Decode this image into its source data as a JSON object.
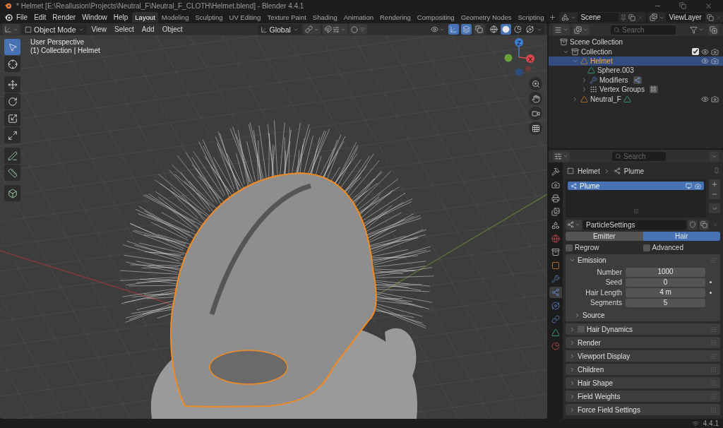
{
  "title_bar": {
    "title": "* Helmet [E:\\Reallusion\\Projects\\Neutral_F\\Neutral_F_CLOTH\\Helmet.blend] - Blender 4.4.1"
  },
  "menus": [
    "File",
    "Edit",
    "Render",
    "Window",
    "Help"
  ],
  "workspaces": [
    {
      "label": "Layout",
      "selected": true
    },
    {
      "label": "Modeling",
      "selected": false
    },
    {
      "label": "Sculpting",
      "selected": false
    },
    {
      "label": "UV Editing",
      "selected": false
    },
    {
      "label": "Texture Paint",
      "selected": false
    },
    {
      "label": "Shading",
      "selected": false
    },
    {
      "label": "Animation",
      "selected": false
    },
    {
      "label": "Rendering",
      "selected": false
    },
    {
      "label": "Compositing",
      "selected": false
    },
    {
      "label": "Geometry Nodes",
      "selected": false
    },
    {
      "label": "Scripting",
      "selected": false
    }
  ],
  "scene": {
    "scene": "Scene",
    "view_layer": "ViewLayer"
  },
  "viewport": {
    "mode": "Object Mode",
    "menus": [
      "View",
      "Select",
      "Add",
      "Object"
    ],
    "orientation": "Global",
    "toggles": [
      {
        "kind": "gizmos",
        "on": true
      },
      {
        "kind": "overlays",
        "on": true
      },
      {
        "kind": "xray",
        "on": false
      }
    ],
    "shading": [
      {
        "kind": "wireframe",
        "selected": false
      },
      {
        "kind": "solid",
        "selected": true
      },
      {
        "kind": "material",
        "selected": false
      },
      {
        "kind": "rendered",
        "selected": false
      }
    ],
    "overlay_text": [
      "User Perspective",
      "(1) Collection | Helmet"
    ],
    "tool_groups": [
      [
        {
          "kind": "select",
          "selected": true
        },
        {
          "kind": "cursor",
          "selected": false
        }
      ],
      [
        {
          "kind": "move",
          "selected": false
        },
        {
          "kind": "rotate",
          "selected": false
        },
        {
          "kind": "scale",
          "selected": false
        },
        {
          "kind": "transform",
          "selected": false
        }
      ],
      [
        {
          "kind": "annotate",
          "selected": false
        },
        {
          "kind": "measure",
          "selected": false
        }
      ],
      [
        {
          "kind": "add_cube",
          "selected": false
        }
      ]
    ],
    "gizmo_labels": [
      "Z",
      "X"
    ]
  },
  "outliner": {
    "search": {
      "placeholder": "Search"
    },
    "tree": [
      {
        "label": "Scene Collection",
        "kind": "scene",
        "children": [
          {
            "label": "Collection",
            "kind": "collection",
            "expanded": true,
            "checked": true,
            "selected": false,
            "children": [
              {
                "label": "Helmet",
                "kind": "object",
                "expanded": true,
                "selected": true,
                "children": [
                  {
                    "label": "Sphere.003",
                    "kind": "mesh",
                    "selected": false
                  },
                  {
                    "label": "Modifiers",
                    "kind": "modifiers",
                    "expanded": false,
                    "selected": false
                  },
                  {
                    "label": "Vertex Groups",
                    "kind": "vertex_groups",
                    "expanded": false,
                    "selected": false
                  }
                ]
              },
              {
                "label": "Neutral_F",
                "kind": "object",
                "expanded": false,
                "selected": false
              }
            ]
          }
        ]
      }
    ]
  },
  "properties": {
    "search": {
      "placeholder": "Search"
    },
    "tabs": [
      {
        "kind": "tool",
        "selected": false
      },
      {
        "kind": "render",
        "selected": false
      },
      {
        "kind": "output",
        "selected": false
      },
      {
        "kind": "view_layer",
        "selected": false
      },
      {
        "kind": "scene",
        "selected": false
      },
      {
        "kind": "world",
        "selected": false
      },
      {
        "kind": "collection",
        "selected": false
      },
      {
        "kind": "object",
        "selected": false
      },
      {
        "kind": "modifiers",
        "selected": false
      },
      {
        "kind": "particles",
        "selected": true
      },
      {
        "kind": "physics",
        "selected": false
      },
      {
        "kind": "constraints",
        "selected": false
      },
      {
        "kind": "data",
        "selected": false
      },
      {
        "kind": "material",
        "selected": false
      }
    ],
    "breadcrumb": [
      "Helmet",
      "Plume"
    ],
    "systems": [
      {
        "label": "Plume",
        "selected": true
      }
    ],
    "settings_name": "ParticleSettings",
    "type": [
      {
        "label": "Emitter",
        "selected": false
      },
      {
        "label": "Hair",
        "selected": true
      }
    ],
    "options": [
      {
        "label": "Regrow",
        "checked": false
      },
      {
        "label": "Advanced",
        "checked": false
      }
    ],
    "panels": [
      {
        "label": "Emission",
        "kind": "plain",
        "expanded": true,
        "fields": [
          {
            "label": "Number",
            "value": "1000",
            "keyframe_dot": false
          },
          {
            "label": "Seed",
            "value": "0",
            "keyframe_dot": true
          },
          {
            "label": "Hair Length",
            "value": "4 m",
            "keyframe_dot": true
          },
          {
            "label": "Segments",
            "value": "5",
            "keyframe_dot": false
          }
        ],
        "subpanels": [
          {
            "label": "Source",
            "expanded": false
          }
        ]
      },
      {
        "label": "Hair Dynamics",
        "kind": "toggle",
        "checked": false,
        "expanded": false
      },
      {
        "label": "Render",
        "kind": "plain",
        "expanded": false
      },
      {
        "label": "Viewport Display",
        "kind": "plain",
        "expanded": false
      },
      {
        "label": "Children",
        "kind": "plain",
        "expanded": false
      },
      {
        "label": "Hair Shape",
        "kind": "plain",
        "expanded": false
      },
      {
        "label": "Field Weights",
        "kind": "plain",
        "expanded": false
      },
      {
        "label": "Force Field Settings",
        "kind": "plain",
        "expanded": false
      }
    ]
  },
  "status_bar": {
    "version": "4.4.1"
  }
}
